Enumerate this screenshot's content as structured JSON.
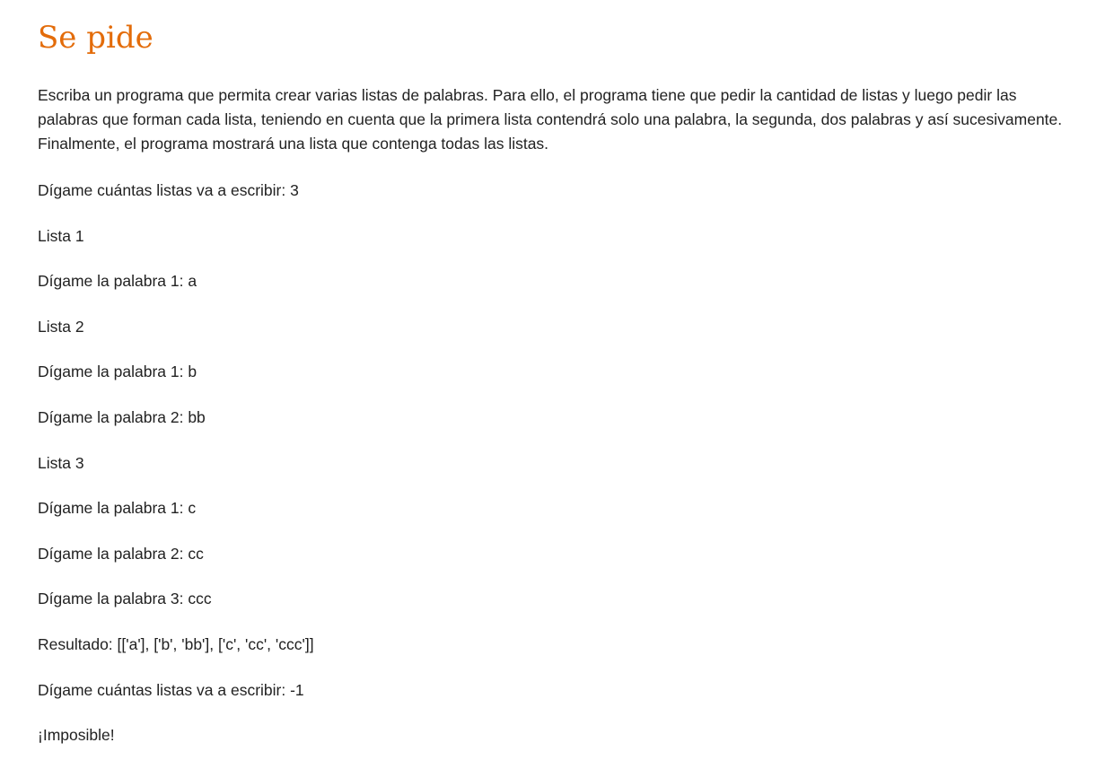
{
  "title": "Se pide",
  "description": "Escriba un programa que permita crear varias listas de palabras. Para ello, el programa tiene que pedir la cantidad de listas y luego pedir las palabras que forman cada lista, teniendo en cuenta que la primera lista contendrá solo una palabra, la segunda, dos palabras y así sucesivamente. Finalmente, el programa mostrará una lista que contenga todas las listas.",
  "session": [
    "Dígame cuántas listas va a escribir: 3",
    "Lista 1",
    "Dígame la palabra 1: a",
    "Lista 2",
    "Dígame la palabra 1: b",
    "Dígame la palabra 2: bb",
    "Lista 3",
    "Dígame la palabra 1: c",
    "Dígame la palabra 2: cc",
    "Dígame la palabra 3: ccc",
    "Resultado: [['a'], ['b', 'bb'], ['c', 'cc', 'ccc']]",
    "Dígame cuántas listas va a escribir: -1",
    "¡Imposible!"
  ],
  "colors": {
    "title": "#e36c0a",
    "text": "#222222",
    "background": "#ffffff"
  }
}
